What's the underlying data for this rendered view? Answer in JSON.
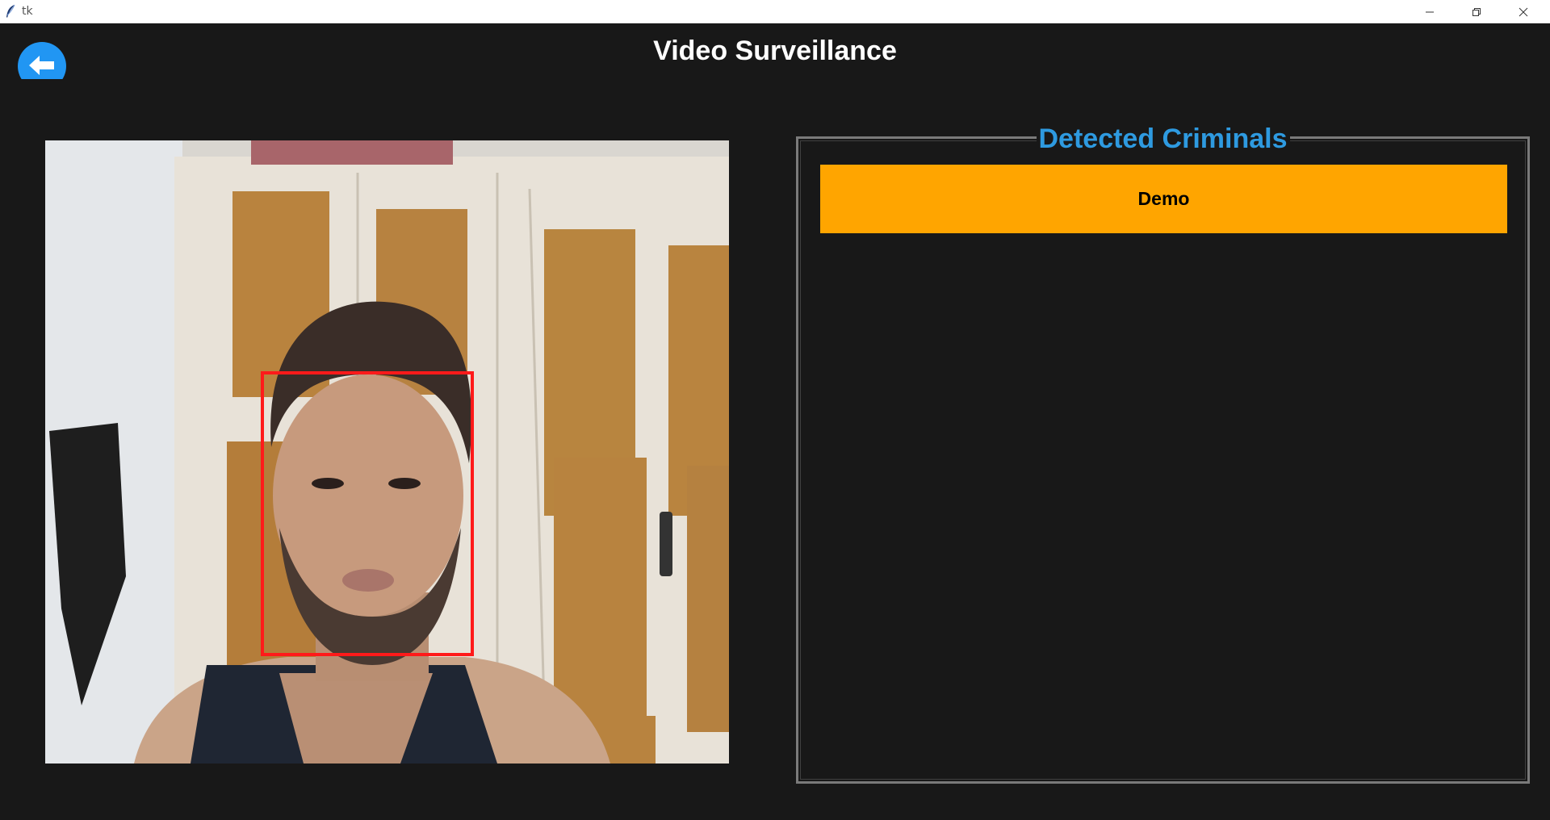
{
  "window": {
    "title": "tk"
  },
  "header": {
    "title": "Video Surveillance",
    "back_icon": "arrow-left-icon"
  },
  "video_feed": {
    "description_icon": "camera-frame",
    "detection_color": "#ff1a1a"
  },
  "detected_panel": {
    "title": "Detected Criminals",
    "title_color": "#2e9ae0",
    "items": [
      {
        "label": "Demo",
        "color": "#ffa500"
      }
    ]
  },
  "colors": {
    "background": "#181818",
    "accent": "#2196f3"
  }
}
